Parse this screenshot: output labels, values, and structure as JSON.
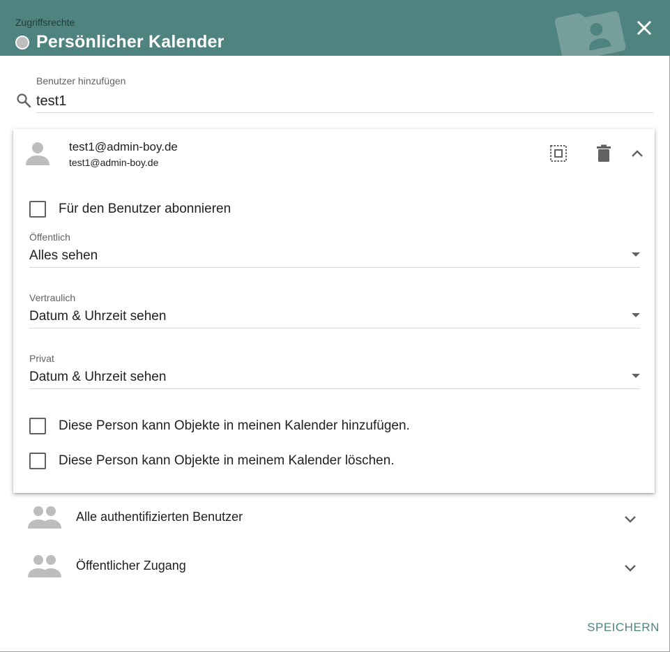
{
  "header": {
    "subtitle": "Zugriffsrechte",
    "title": "Persönlicher Kalender"
  },
  "search": {
    "label": "Benutzer hinzufügen",
    "value": "test1"
  },
  "user_card": {
    "name": "test1@admin-boy.de",
    "email": "test1@admin-boy.de",
    "subscribe_label": "Für den Benutzer abonnieren",
    "subscribe_checked": false,
    "public": {
      "label": "Öffentlich",
      "value": "Alles sehen"
    },
    "confidential": {
      "label": "Vertraulich",
      "value": "Datum & Uhrzeit sehen"
    },
    "private": {
      "label": "Privat",
      "value": "Datum & Uhrzeit sehen"
    },
    "can_add_label": "Diese Person kann Objekte in meinen Kalender hinzufügen.",
    "can_add_checked": false,
    "can_delete_label": "Diese Person kann Objekte in meinem Kalender löschen.",
    "can_delete_checked": false
  },
  "groups": [
    {
      "label": "Alle authentifizierten Benutzer",
      "icon": "group-icon"
    },
    {
      "label": "Öffentlicher Zugang",
      "icon": "group-icon"
    }
  ],
  "footer": {
    "save_label": "SPEICHERN"
  },
  "colors": {
    "header_bg": "#4e8380",
    "accent": "#4e8380",
    "icon_gray": "#9e9e9e"
  }
}
